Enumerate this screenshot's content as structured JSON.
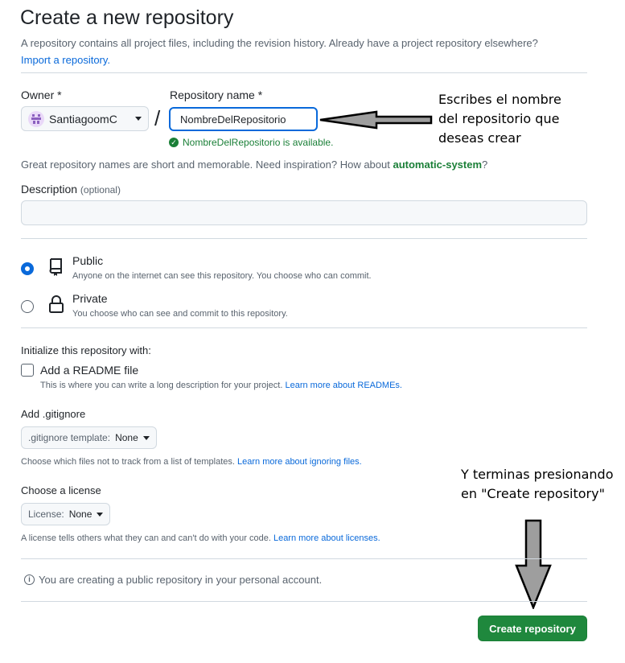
{
  "header": {
    "title": "Create a new repository",
    "subtitle": "A repository contains all project files, including the revision history. Already have a project repository elsewhere?",
    "import_link": "Import a repository."
  },
  "owner": {
    "label": "Owner *",
    "value": "SantiagoomC"
  },
  "repo_name": {
    "label": "Repository name *",
    "value": "NombreDelRepositorio",
    "availability": "NombreDelRepositorio is available."
  },
  "hint": {
    "text": "Great repository names are short and memorable. Need inspiration? How about",
    "suggestion": "automatic-system",
    "suffix": "?"
  },
  "description": {
    "label": "Description",
    "optional": "(optional)",
    "value": ""
  },
  "visibility": {
    "public": {
      "title": "Public",
      "desc": "Anyone on the internet can see this repository. You choose who can commit.",
      "selected": true
    },
    "private": {
      "title": "Private",
      "desc": "You choose who can see and commit to this repository.",
      "selected": false
    }
  },
  "init": {
    "heading": "Initialize this repository with:",
    "readme_label": "Add a README file",
    "readme_desc": "This is where you can write a long description for your project.",
    "readme_link": "Learn more about READMEs.",
    "readme_checked": false
  },
  "gitignore": {
    "heading": "Add .gitignore",
    "select_prefix": ".gitignore template:",
    "select_value": "None",
    "desc": "Choose which files not to track from a list of templates.",
    "link": "Learn more about ignoring files."
  },
  "license": {
    "heading": "Choose a license",
    "select_prefix": "License:",
    "select_value": "None",
    "desc": "A license tells others what they can and can't do with your code.",
    "link": "Learn more about licenses."
  },
  "info_message": "You are creating a public repository in your personal account.",
  "create_button": "Create repository",
  "annotations": {
    "name_note": [
      "Escribes el nombre",
      "del repositorio que",
      "deseas crear"
    ],
    "create_note": [
      "Y terminas presionando",
      "en \"Create repository\""
    ]
  },
  "colors": {
    "accent_blue": "#0969da",
    "success_green": "#1a7f37",
    "button_green": "#1f883d"
  }
}
